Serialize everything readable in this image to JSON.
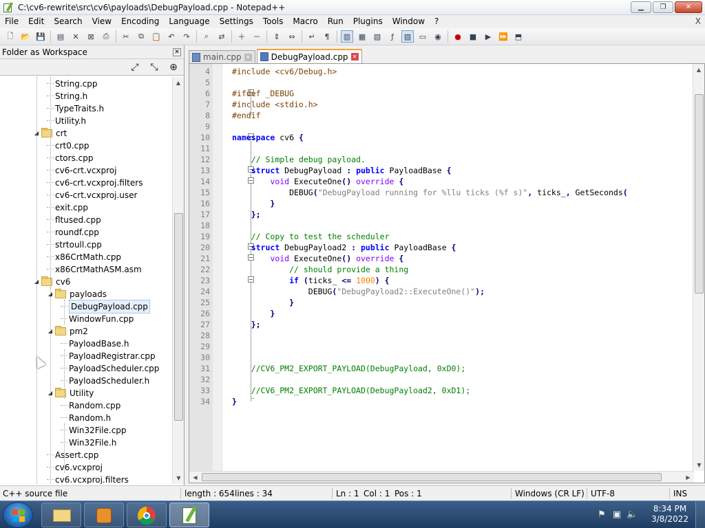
{
  "window": {
    "title": "C:\\cv6-rewrite\\src\\cv6\\payloads\\DebugPayload.cpp - Notepad++",
    "menu_close": "X"
  },
  "menu": [
    "File",
    "Edit",
    "Search",
    "View",
    "Encoding",
    "Language",
    "Settings",
    "Tools",
    "Macro",
    "Run",
    "Plugins",
    "Window",
    "?"
  ],
  "toolbar_icons": [
    "new-file-icon",
    "open-file-icon",
    "save-icon",
    "save-all-icon",
    "close-icon",
    "close-all-icon",
    "print-icon",
    "cut-icon",
    "copy-icon",
    "paste-icon",
    "undo-icon",
    "redo-icon",
    "find-icon",
    "replace-icon",
    "zoom-in-icon",
    "zoom-out-icon",
    "sync-vertical-icon",
    "sync-horizontal-icon",
    "word-wrap-icon",
    "show-all-chars-icon",
    "indent-guide-icon",
    "lang-define-icon",
    "doc-map-icon",
    "function-list-icon",
    "folder-workspace-icon",
    "monitor-icon",
    "eye-icon",
    "record-macro-icon",
    "stop-macro-icon",
    "play-macro-icon",
    "run-macro-multiple-icon",
    "save-macro-icon"
  ],
  "left_panel": {
    "title": "Folder as Workspace",
    "tree": [
      {
        "label": "String.cpp",
        "depth": 2,
        "folder": false
      },
      {
        "label": "String.h",
        "depth": 2,
        "folder": false
      },
      {
        "label": "TypeTraits.h",
        "depth": 2,
        "folder": false
      },
      {
        "label": "Utility.h",
        "depth": 2,
        "folder": false
      },
      {
        "label": "crt",
        "depth": 1,
        "folder": true
      },
      {
        "label": "crt0.cpp",
        "depth": 2,
        "folder": false
      },
      {
        "label": "ctors.cpp",
        "depth": 2,
        "folder": false
      },
      {
        "label": "cv6-crt.vcxproj",
        "depth": 2,
        "folder": false
      },
      {
        "label": "cv6-crt.vcxproj.filters",
        "depth": 2,
        "folder": false
      },
      {
        "label": "cv6-crt.vcxproj.user",
        "depth": 2,
        "folder": false
      },
      {
        "label": "exit.cpp",
        "depth": 2,
        "folder": false
      },
      {
        "label": "fltused.cpp",
        "depth": 2,
        "folder": false
      },
      {
        "label": "roundf.cpp",
        "depth": 2,
        "folder": false
      },
      {
        "label": "strtoull.cpp",
        "depth": 2,
        "folder": false
      },
      {
        "label": "x86CrtMath.cpp",
        "depth": 2,
        "folder": false
      },
      {
        "label": "x86CrtMathASM.asm",
        "depth": 2,
        "folder": false
      },
      {
        "label": "cv6",
        "depth": 1,
        "folder": true
      },
      {
        "label": "payloads",
        "depth": 2,
        "folder": true
      },
      {
        "label": "DebugPayload.cpp",
        "depth": 3,
        "folder": false,
        "selected": true
      },
      {
        "label": "WindowFun.cpp",
        "depth": 3,
        "folder": false
      },
      {
        "label": "pm2",
        "depth": 2,
        "folder": true
      },
      {
        "label": "PayloadBase.h",
        "depth": 3,
        "folder": false
      },
      {
        "label": "PayloadRegistrar.cpp",
        "depth": 3,
        "folder": false
      },
      {
        "label": "PayloadScheduler.cpp",
        "depth": 3,
        "folder": false
      },
      {
        "label": "PayloadScheduler.h",
        "depth": 3,
        "folder": false
      },
      {
        "label": "Utility",
        "depth": 2,
        "folder": true
      },
      {
        "label": "Random.cpp",
        "depth": 3,
        "folder": false
      },
      {
        "label": "Random.h",
        "depth": 3,
        "folder": false
      },
      {
        "label": "Win32File.cpp",
        "depth": 3,
        "folder": false
      },
      {
        "label": "Win32File.h",
        "depth": 3,
        "folder": false
      },
      {
        "label": "Assert.cpp",
        "depth": 2,
        "folder": false
      },
      {
        "label": "cv6.vcxproj",
        "depth": 2,
        "folder": false
      },
      {
        "label": "cv6.vcxproj.filters",
        "depth": 2,
        "folder": false
      }
    ]
  },
  "tabs": [
    {
      "label": "main.cpp",
      "active": false
    },
    {
      "label": "DebugPayload.cpp",
      "active": true
    }
  ],
  "code_lines": [
    {
      "n": "4",
      "html": "<span class=\"pp\">#include &lt;cv6/Debug.h&gt;</span>"
    },
    {
      "n": "5",
      "html": ""
    },
    {
      "n": "6",
      "html": "<span class=\"pp\">#ifdef _DEBUG</span>"
    },
    {
      "n": "7",
      "html": "<span class=\"pp\">#include &lt;stdio.h&gt;</span>"
    },
    {
      "n": "8",
      "html": "<span class=\"pp\">#endif</span>"
    },
    {
      "n": "9",
      "html": ""
    },
    {
      "n": "10",
      "html": "<span class=\"kw\">namespace</span> cv6 <span class=\"op\">{</span>"
    },
    {
      "n": "11",
      "html": ""
    },
    {
      "n": "12",
      "html": "    <span class=\"cm\">// Simple debug payload.</span>"
    },
    {
      "n": "13",
      "html": "    <span class=\"kw\">struct</span> DebugPayload <span class=\"op\">:</span> <span class=\"kw\">public</span> PayloadBase <span class=\"op\">{</span>"
    },
    {
      "n": "14",
      "html": "        <span class=\"kw2\">void</span> ExecuteOne<span class=\"op\">()</span> <span class=\"kw2\">override</span> <span class=\"op\">{</span>"
    },
    {
      "n": "15",
      "html": "            DEBUG<span class=\"op\">(</span><span class=\"st\">\"DebugPayload running for %llu ticks (%f s)\"</span><span class=\"op\">,</span> ticks_<span class=\"op\">,</span> GetSeconds<span class=\"op\">(</span>"
    },
    {
      "n": "16",
      "html": "        <span class=\"op\">}</span>"
    },
    {
      "n": "17",
      "html": "    <span class=\"op\">};</span>"
    },
    {
      "n": "18",
      "html": ""
    },
    {
      "n": "19",
      "html": "    <span class=\"cm\">// Copy to test the scheduler</span>"
    },
    {
      "n": "20",
      "html": "    <span class=\"kw\">struct</span> DebugPayload2 <span class=\"op\">:</span> <span class=\"kw\">public</span> PayloadBase <span class=\"op\">{</span>"
    },
    {
      "n": "21",
      "html": "        <span class=\"kw2\">void</span> ExecuteOne<span class=\"op\">()</span> <span class=\"kw2\">override</span> <span class=\"op\">{</span>"
    },
    {
      "n": "22",
      "html": "            <span class=\"cm\">// should provide a thing</span>"
    },
    {
      "n": "23",
      "html": "            <span class=\"kw\">if</span> <span class=\"op\">(</span>ticks_ <span class=\"op\">&lt;=</span> <span class=\"num\">1000</span><span class=\"op\">)</span> <span class=\"op\">{</span>"
    },
    {
      "n": "24",
      "html": "                DEBUG<span class=\"op\">(</span><span class=\"st\">\"DebugPayload2::ExecuteOne()\"</span><span class=\"op\">);</span>"
    },
    {
      "n": "25",
      "html": "            <span class=\"op\">}</span>"
    },
    {
      "n": "26",
      "html": "        <span class=\"op\">}</span>"
    },
    {
      "n": "27",
      "html": "    <span class=\"op\">};</span>"
    },
    {
      "n": "28",
      "html": ""
    },
    {
      "n": "29",
      "html": ""
    },
    {
      "n": "30",
      "html": ""
    },
    {
      "n": "31",
      "html": "    <span class=\"cm\">//CV6_PM2_EXPORT_PAYLOAD(DebugPayload, 0xD0);</span>"
    },
    {
      "n": "32",
      "html": ""
    },
    {
      "n": "33",
      "html": "    <span class=\"cm\">//CV6_PM2_EXPORT_PAYLOAD(DebugPayload2, 0xD1);</span>"
    },
    {
      "n": "34",
      "html": "<span class=\"op\">}</span>"
    }
  ],
  "status": {
    "filetype": "C++ source file",
    "length": "length : 654",
    "lines": "lines : 34",
    "ln": "Ln : 1",
    "col": "Col : 1",
    "pos": "Pos : 1",
    "eol": "Windows (CR LF)",
    "encoding": "UTF-8",
    "mode": "INS"
  },
  "taskbar": {
    "apps": [
      "explorer",
      "media-player",
      "chrome",
      "notepad-plus-plus"
    ],
    "time": "8:34 PM",
    "date": "3/8/2022"
  }
}
